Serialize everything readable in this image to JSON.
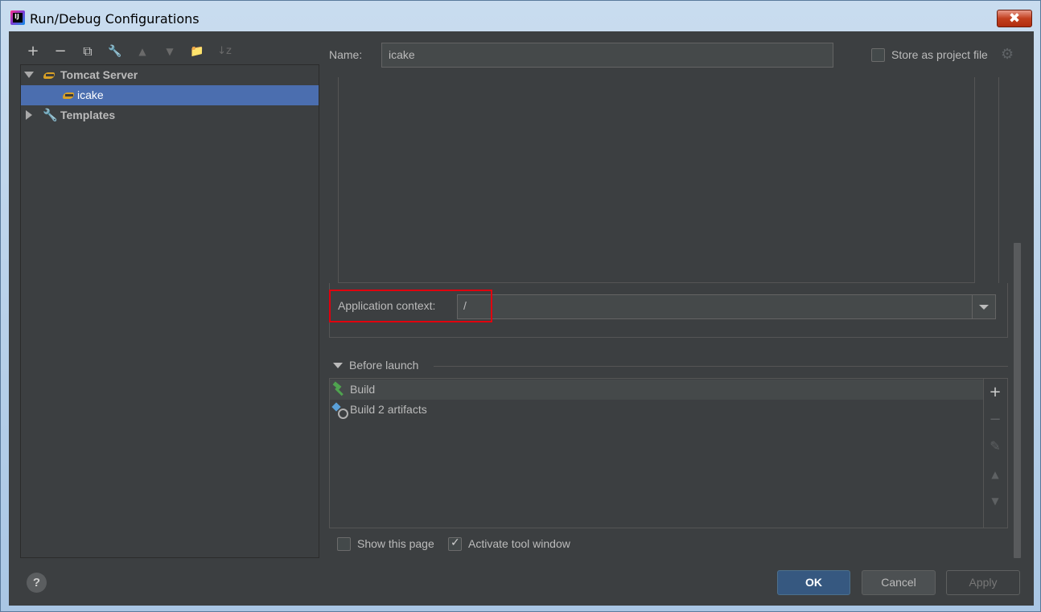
{
  "window": {
    "title": "Run/Debug Configurations",
    "close_glyph": "✖"
  },
  "toolbar": {
    "add": "+",
    "remove": "−",
    "copy": "⧉",
    "edit": "🔧",
    "up": "▲",
    "down": "▼",
    "folder": "📁",
    "sort": "↓z"
  },
  "tree": {
    "tomcat_server": "Tomcat Server",
    "icake": "icake",
    "templates": "Templates"
  },
  "form": {
    "name_label": "Name:",
    "name_value": "icake",
    "store_label": "Store as project file",
    "store_checked": false,
    "app_context_label": "Application context:",
    "app_context_value": "/"
  },
  "before_launch": {
    "title": "Before launch",
    "items": [
      "Build",
      "Build 2 artifacts"
    ],
    "tools": {
      "add": "+",
      "remove": "−",
      "edit": "✎",
      "up": "▲",
      "down": "▼"
    }
  },
  "options": {
    "show_page_label": "Show this page",
    "show_page_checked": false,
    "activate_label": "Activate tool window",
    "activate_checked": true
  },
  "buttons": {
    "help": "?",
    "ok": "OK",
    "cancel": "Cancel",
    "apply": "Apply"
  },
  "colors": {
    "background": "#3c3f41",
    "selection": "#4b6eaf",
    "highlight_border": "#e0000e",
    "primary_button": "#365880"
  }
}
